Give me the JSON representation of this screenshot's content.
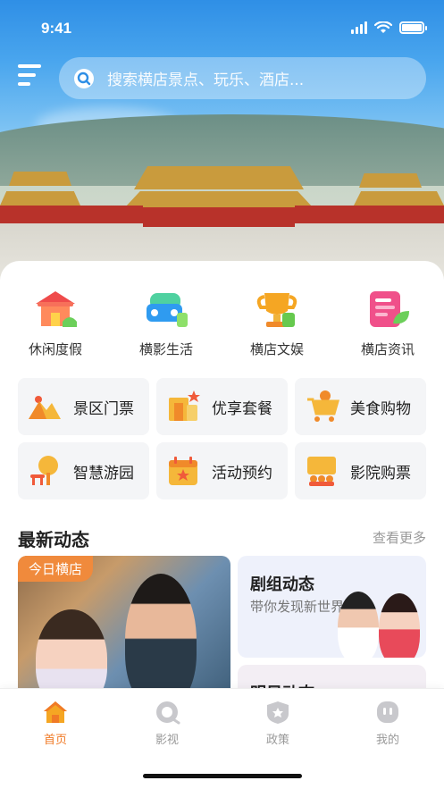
{
  "status_bar": {
    "time": "9:41"
  },
  "search": {
    "placeholder": "搜索横店景点、玩乐、酒店..."
  },
  "categories": [
    {
      "label": "休闲度假",
      "icon": "house-icon",
      "color": "#ef4b4b"
    },
    {
      "label": "横影生活",
      "icon": "car-icon",
      "color": "#2f9bf0"
    },
    {
      "label": "横店文娱",
      "icon": "trophy-icon",
      "color": "#f5a623"
    },
    {
      "label": "横店资讯",
      "icon": "news-icon",
      "color": "#f0508a"
    }
  ],
  "services": [
    {
      "label": "景区门票",
      "icon": "ticket-icon"
    },
    {
      "label": "优享套餐",
      "icon": "package-icon"
    },
    {
      "label": "美食购物",
      "icon": "shopping-cart-icon"
    },
    {
      "label": "智慧游园",
      "icon": "tree-icon"
    },
    {
      "label": "活动预约",
      "icon": "calendar-icon"
    },
    {
      "label": "影院购票",
      "icon": "cinema-icon"
    }
  ],
  "news_section": {
    "title": "最新动态",
    "more": "查看更多"
  },
  "news": {
    "featured_tag": "今日横店",
    "crew_title": "剧组动态",
    "crew_subtitle": "带你发现新世界",
    "star_title": "明星动态"
  },
  "tabs": [
    {
      "label": "首页",
      "icon": "home-icon",
      "active": true
    },
    {
      "label": "影视",
      "icon": "film-icon",
      "active": false
    },
    {
      "label": "政策",
      "icon": "shield-icon",
      "active": false
    },
    {
      "label": "我的",
      "icon": "profile-icon",
      "active": false
    }
  ],
  "colors": {
    "accent": "#f07a26",
    "tab_inactive": "#999999"
  }
}
